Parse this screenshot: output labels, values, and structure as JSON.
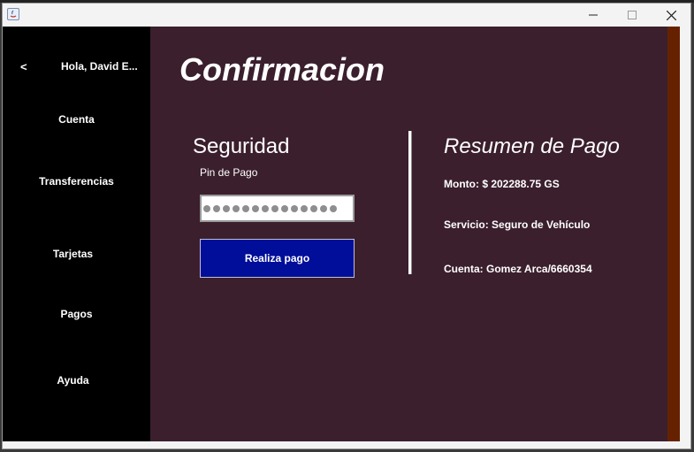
{
  "window": {
    "controls": {
      "minimize": "—",
      "maximize": "☐",
      "close": "✕"
    },
    "icon": "java-app-icon"
  },
  "sidebar": {
    "back_label": "<",
    "greeting": "Hola, David E...",
    "items": [
      {
        "label": "Cuenta"
      },
      {
        "label": "Transferencias"
      },
      {
        "label": "Tarjetas"
      },
      {
        "label": "Pagos"
      },
      {
        "label": "Ayuda"
      }
    ]
  },
  "main": {
    "title": "Confirmacion",
    "security": {
      "title": "Seguridad",
      "pin_label": "Pin de Pago",
      "pin_mask_count": 14,
      "submit_label": "Realiza pago"
    },
    "summary": {
      "title": "Resumen de Pago",
      "amount": "Monto: $ 202288.75 GS",
      "service": "Servicio: Seguro de Vehículo",
      "account": "Cuenta: Gomez Arca/6660354"
    }
  },
  "colors": {
    "sidebar_bg": "#000000",
    "main_bg": "#3b1f2d",
    "accent_bar": "#662200",
    "button_bg": "#000e99"
  }
}
